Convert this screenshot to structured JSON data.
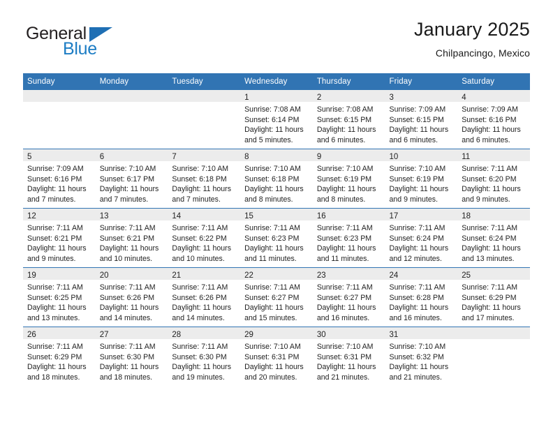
{
  "brand": {
    "line1": "General",
    "line2": "Blue",
    "triangle_color": "#1f6fb4",
    "blue_text_color": "#1d7dc4"
  },
  "header": {
    "title": "January 2025",
    "subtitle": "Chilpancingo, Mexico"
  },
  "theme": {
    "header_row_bg": "#3174b3",
    "daynum_band_bg": "#ececec",
    "page_bg": "#ffffff",
    "text_color": "#222222"
  },
  "calendar": {
    "weekday_headers": [
      "Sunday",
      "Monday",
      "Tuesday",
      "Wednesday",
      "Thursday",
      "Friday",
      "Saturday"
    ],
    "weeks": [
      [
        {
          "day": "",
          "empty": true,
          "lines": []
        },
        {
          "day": "",
          "empty": true,
          "lines": []
        },
        {
          "day": "",
          "empty": true,
          "lines": []
        },
        {
          "day": "1",
          "empty": false,
          "lines": [
            "Sunrise: 7:08 AM",
            "Sunset: 6:14 PM",
            "Daylight: 11 hours and 5 minutes."
          ]
        },
        {
          "day": "2",
          "empty": false,
          "lines": [
            "Sunrise: 7:08 AM",
            "Sunset: 6:15 PM",
            "Daylight: 11 hours and 6 minutes."
          ]
        },
        {
          "day": "3",
          "empty": false,
          "lines": [
            "Sunrise: 7:09 AM",
            "Sunset: 6:15 PM",
            "Daylight: 11 hours and 6 minutes."
          ]
        },
        {
          "day": "4",
          "empty": false,
          "lines": [
            "Sunrise: 7:09 AM",
            "Sunset: 6:16 PM",
            "Daylight: 11 hours and 6 minutes."
          ]
        }
      ],
      [
        {
          "day": "5",
          "empty": false,
          "lines": [
            "Sunrise: 7:09 AM",
            "Sunset: 6:16 PM",
            "Daylight: 11 hours and 7 minutes."
          ]
        },
        {
          "day": "6",
          "empty": false,
          "lines": [
            "Sunrise: 7:10 AM",
            "Sunset: 6:17 PM",
            "Daylight: 11 hours and 7 minutes."
          ]
        },
        {
          "day": "7",
          "empty": false,
          "lines": [
            "Sunrise: 7:10 AM",
            "Sunset: 6:18 PM",
            "Daylight: 11 hours and 7 minutes."
          ]
        },
        {
          "day": "8",
          "empty": false,
          "lines": [
            "Sunrise: 7:10 AM",
            "Sunset: 6:18 PM",
            "Daylight: 11 hours and 8 minutes."
          ]
        },
        {
          "day": "9",
          "empty": false,
          "lines": [
            "Sunrise: 7:10 AM",
            "Sunset: 6:19 PM",
            "Daylight: 11 hours and 8 minutes."
          ]
        },
        {
          "day": "10",
          "empty": false,
          "lines": [
            "Sunrise: 7:10 AM",
            "Sunset: 6:19 PM",
            "Daylight: 11 hours and 9 minutes."
          ]
        },
        {
          "day": "11",
          "empty": false,
          "lines": [
            "Sunrise: 7:11 AM",
            "Sunset: 6:20 PM",
            "Daylight: 11 hours and 9 minutes."
          ]
        }
      ],
      [
        {
          "day": "12",
          "empty": false,
          "lines": [
            "Sunrise: 7:11 AM",
            "Sunset: 6:21 PM",
            "Daylight: 11 hours and 9 minutes."
          ]
        },
        {
          "day": "13",
          "empty": false,
          "lines": [
            "Sunrise: 7:11 AM",
            "Sunset: 6:21 PM",
            "Daylight: 11 hours and 10 minutes."
          ]
        },
        {
          "day": "14",
          "empty": false,
          "lines": [
            "Sunrise: 7:11 AM",
            "Sunset: 6:22 PM",
            "Daylight: 11 hours and 10 minutes."
          ]
        },
        {
          "day": "15",
          "empty": false,
          "lines": [
            "Sunrise: 7:11 AM",
            "Sunset: 6:23 PM",
            "Daylight: 11 hours and 11 minutes."
          ]
        },
        {
          "day": "16",
          "empty": false,
          "lines": [
            "Sunrise: 7:11 AM",
            "Sunset: 6:23 PM",
            "Daylight: 11 hours and 11 minutes."
          ]
        },
        {
          "day": "17",
          "empty": false,
          "lines": [
            "Sunrise: 7:11 AM",
            "Sunset: 6:24 PM",
            "Daylight: 11 hours and 12 minutes."
          ]
        },
        {
          "day": "18",
          "empty": false,
          "lines": [
            "Sunrise: 7:11 AM",
            "Sunset: 6:24 PM",
            "Daylight: 11 hours and 13 minutes."
          ]
        }
      ],
      [
        {
          "day": "19",
          "empty": false,
          "lines": [
            "Sunrise: 7:11 AM",
            "Sunset: 6:25 PM",
            "Daylight: 11 hours and 13 minutes."
          ]
        },
        {
          "day": "20",
          "empty": false,
          "lines": [
            "Sunrise: 7:11 AM",
            "Sunset: 6:26 PM",
            "Daylight: 11 hours and 14 minutes."
          ]
        },
        {
          "day": "21",
          "empty": false,
          "lines": [
            "Sunrise: 7:11 AM",
            "Sunset: 6:26 PM",
            "Daylight: 11 hours and 14 minutes."
          ]
        },
        {
          "day": "22",
          "empty": false,
          "lines": [
            "Sunrise: 7:11 AM",
            "Sunset: 6:27 PM",
            "Daylight: 11 hours and 15 minutes."
          ]
        },
        {
          "day": "23",
          "empty": false,
          "lines": [
            "Sunrise: 7:11 AM",
            "Sunset: 6:27 PM",
            "Daylight: 11 hours and 16 minutes."
          ]
        },
        {
          "day": "24",
          "empty": false,
          "lines": [
            "Sunrise: 7:11 AM",
            "Sunset: 6:28 PM",
            "Daylight: 11 hours and 16 minutes."
          ]
        },
        {
          "day": "25",
          "empty": false,
          "lines": [
            "Sunrise: 7:11 AM",
            "Sunset: 6:29 PM",
            "Daylight: 11 hours and 17 minutes."
          ]
        }
      ],
      [
        {
          "day": "26",
          "empty": false,
          "lines": [
            "Sunrise: 7:11 AM",
            "Sunset: 6:29 PM",
            "Daylight: 11 hours and 18 minutes."
          ]
        },
        {
          "day": "27",
          "empty": false,
          "lines": [
            "Sunrise: 7:11 AM",
            "Sunset: 6:30 PM",
            "Daylight: 11 hours and 18 minutes."
          ]
        },
        {
          "day": "28",
          "empty": false,
          "lines": [
            "Sunrise: 7:11 AM",
            "Sunset: 6:30 PM",
            "Daylight: 11 hours and 19 minutes."
          ]
        },
        {
          "day": "29",
          "empty": false,
          "lines": [
            "Sunrise: 7:10 AM",
            "Sunset: 6:31 PM",
            "Daylight: 11 hours and 20 minutes."
          ]
        },
        {
          "day": "30",
          "empty": false,
          "lines": [
            "Sunrise: 7:10 AM",
            "Sunset: 6:31 PM",
            "Daylight: 11 hours and 21 minutes."
          ]
        },
        {
          "day": "31",
          "empty": false,
          "lines": [
            "Sunrise: 7:10 AM",
            "Sunset: 6:32 PM",
            "Daylight: 11 hours and 21 minutes."
          ]
        },
        {
          "day": "",
          "empty": true,
          "lines": []
        }
      ]
    ]
  }
}
